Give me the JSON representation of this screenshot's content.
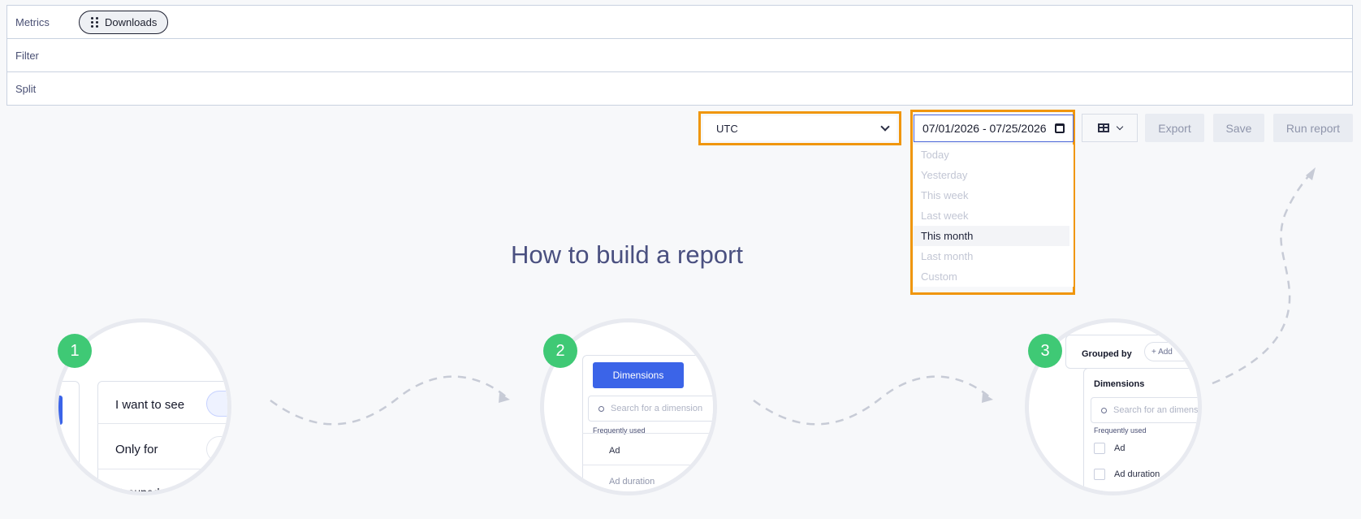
{
  "query": {
    "metrics_label": "Metrics",
    "metric_chip": "Downloads",
    "filter_label": "Filter",
    "split_label": "Split"
  },
  "toolbar": {
    "timezone": "UTC",
    "date_range": "07/01/2026 - 07/25/2026",
    "export_label": "Export",
    "save_label": "Save",
    "run_label": "Run report"
  },
  "date_menu": {
    "items": [
      "Today",
      "Yesterday",
      "This week",
      "Last week",
      "This month",
      "Last month",
      "Custom"
    ],
    "selected": "This month"
  },
  "guide": {
    "title": "How to build a report",
    "steps": [
      {
        "number": "1",
        "rows": [
          "I want to see",
          "Only for"
        ],
        "cut_text": "Grouped"
      },
      {
        "number": "2",
        "tab": "Dimensions",
        "search_placeholder": "Search for a dimension",
        "section": "Frequently used",
        "item": "Ad",
        "cut_text": "Ad duration"
      },
      {
        "number": "3",
        "grouped_by": "Grouped by",
        "add_label": "+ Add",
        "panel_title": "Dimensions",
        "search_placeholder": "Search for an dimension",
        "section": "Frequently used",
        "items": [
          "Ad",
          "Ad duration"
        ]
      }
    ]
  },
  "colors": {
    "highlight": "#f0960c",
    "accent": "#3b64e8",
    "step_badge": "#3fc975"
  }
}
